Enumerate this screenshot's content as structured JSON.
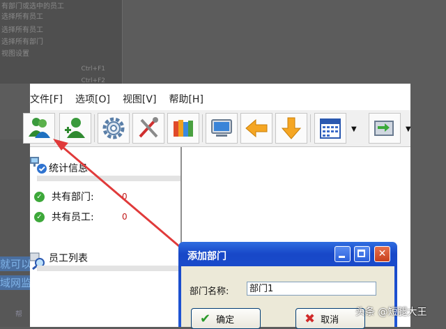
{
  "background": {
    "menu_lines": [
      "有部门或选中的员工",
      "选择所有员工",
      "选择所有员工",
      "选择所有部门",
      "视图设置"
    ],
    "shortcuts": [
      "Ctrl+F1",
      "Ctrl+F2"
    ],
    "left_text": [
      "就可以",
      "域网监"
    ],
    "bottom_text": "帮"
  },
  "menu": [
    "文件[F]",
    "选项[O]",
    "视图[V]",
    "帮助[H]"
  ],
  "toolbar": {
    "buttons": [
      {
        "icon": "add-department-icon"
      },
      {
        "icon": "add-employee-icon"
      },
      {
        "icon": "settings-gear-icon"
      },
      {
        "icon": "tools-icon"
      },
      {
        "icon": "books-icon"
      },
      {
        "icon": "monitor-icon"
      },
      {
        "icon": "arrow-left-icon"
      },
      {
        "icon": "arrow-down-icon"
      },
      {
        "icon": "calendar-icon"
      },
      {
        "icon": "network-card-icon"
      }
    ]
  },
  "left_panel": {
    "stats_title": "统计信息",
    "departments_label": "共有部门:",
    "departments_count": "0",
    "employees_label": "共有员工:",
    "employees_count": "0",
    "employee_list_title": "员工列表"
  },
  "dialog": {
    "title": "添加部门",
    "name_label": "部门名称:",
    "name_value": "部门1",
    "ok_label": "确定",
    "cancel_label": "取消"
  },
  "watermark": "头条 @短腿大王",
  "colors": {
    "dialog_titlebar": "#1f56d6",
    "annotation_arrow": "#e03a3a",
    "count_red": "#c01818"
  }
}
